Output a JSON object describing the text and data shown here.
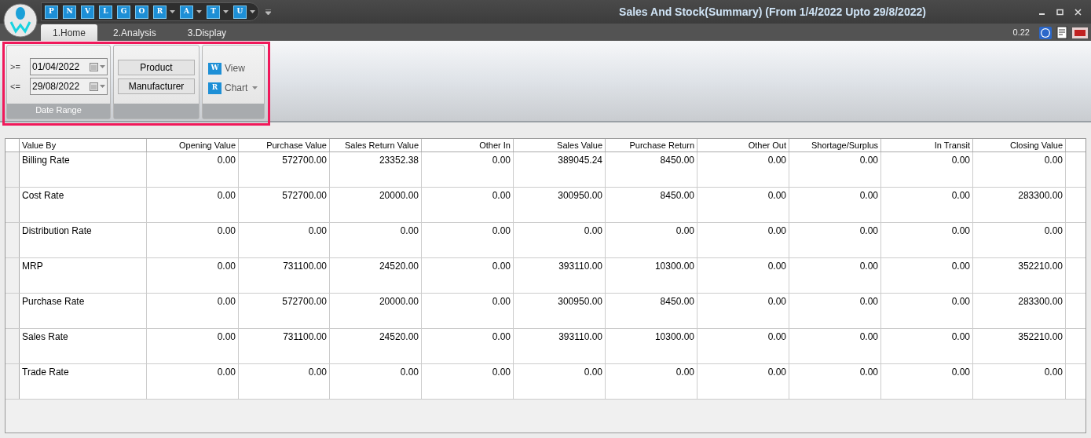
{
  "window": {
    "title": "Sales And Stock(Summary) (From 1/4/2022 Upto 29/8/2022)"
  },
  "quick_access": [
    {
      "letter": "P",
      "dropdown": false
    },
    {
      "letter": "N",
      "dropdown": false
    },
    {
      "letter": "V",
      "dropdown": false
    },
    {
      "letter": "L",
      "dropdown": false
    },
    {
      "letter": "G",
      "dropdown": false
    },
    {
      "letter": "O",
      "dropdown": false
    },
    {
      "letter": "R",
      "dropdown": true
    },
    {
      "letter": "A",
      "dropdown": true
    },
    {
      "letter": "T",
      "dropdown": true
    },
    {
      "letter": "U",
      "dropdown": true
    }
  ],
  "tabs": [
    {
      "label": "1.Home",
      "selected": true
    },
    {
      "label": "2.Analysis",
      "selected": false
    },
    {
      "label": "3.Display",
      "selected": false
    }
  ],
  "version": "0.22",
  "ribbon": {
    "date_range": {
      "label": "Date Range",
      "fields": [
        {
          "operator": ">=",
          "value": "01/04/2022"
        },
        {
          "operator": "<=",
          "value": "29/08/2022"
        }
      ]
    },
    "group_by": [
      "Product",
      "Manufacturer"
    ],
    "actions": [
      {
        "label": "View",
        "letter": "W",
        "dropdown": false
      },
      {
        "label": "Chart",
        "letter": "R",
        "dropdown": true
      }
    ]
  },
  "table": {
    "columns": [
      "Value By",
      "Opening Value",
      "Purchase Value",
      "Sales Return Value",
      "Other In",
      "Sales Value",
      "Purchase Return",
      "Other Out",
      "Shortage/Surplus",
      "In Transit",
      "Closing Value"
    ],
    "rows": [
      [
        "Billing Rate",
        "0.00",
        "572700.00",
        "23352.38",
        "0.00",
        "389045.24",
        "8450.00",
        "0.00",
        "0.00",
        "0.00",
        "0.00"
      ],
      [
        "Cost Rate",
        "0.00",
        "572700.00",
        "20000.00",
        "0.00",
        "300950.00",
        "8450.00",
        "0.00",
        "0.00",
        "0.00",
        "283300.00"
      ],
      [
        "Distribution Rate",
        "0.00",
        "0.00",
        "0.00",
        "0.00",
        "0.00",
        "0.00",
        "0.00",
        "0.00",
        "0.00",
        "0.00"
      ],
      [
        "MRP",
        "0.00",
        "731100.00",
        "24520.00",
        "0.00",
        "393110.00",
        "10300.00",
        "0.00",
        "0.00",
        "0.00",
        "352210.00"
      ],
      [
        "Purchase Rate",
        "0.00",
        "572700.00",
        "20000.00",
        "0.00",
        "300950.00",
        "8450.00",
        "0.00",
        "0.00",
        "0.00",
        "283300.00"
      ],
      [
        "Sales Rate",
        "0.00",
        "731100.00",
        "24520.00",
        "0.00",
        "393110.00",
        "10300.00",
        "0.00",
        "0.00",
        "0.00",
        "352210.00"
      ],
      [
        "Trade Rate",
        "0.00",
        "0.00",
        "0.00",
        "0.00",
        "0.00",
        "0.00",
        "0.00",
        "0.00",
        "0.00",
        "0.00"
      ]
    ]
  }
}
